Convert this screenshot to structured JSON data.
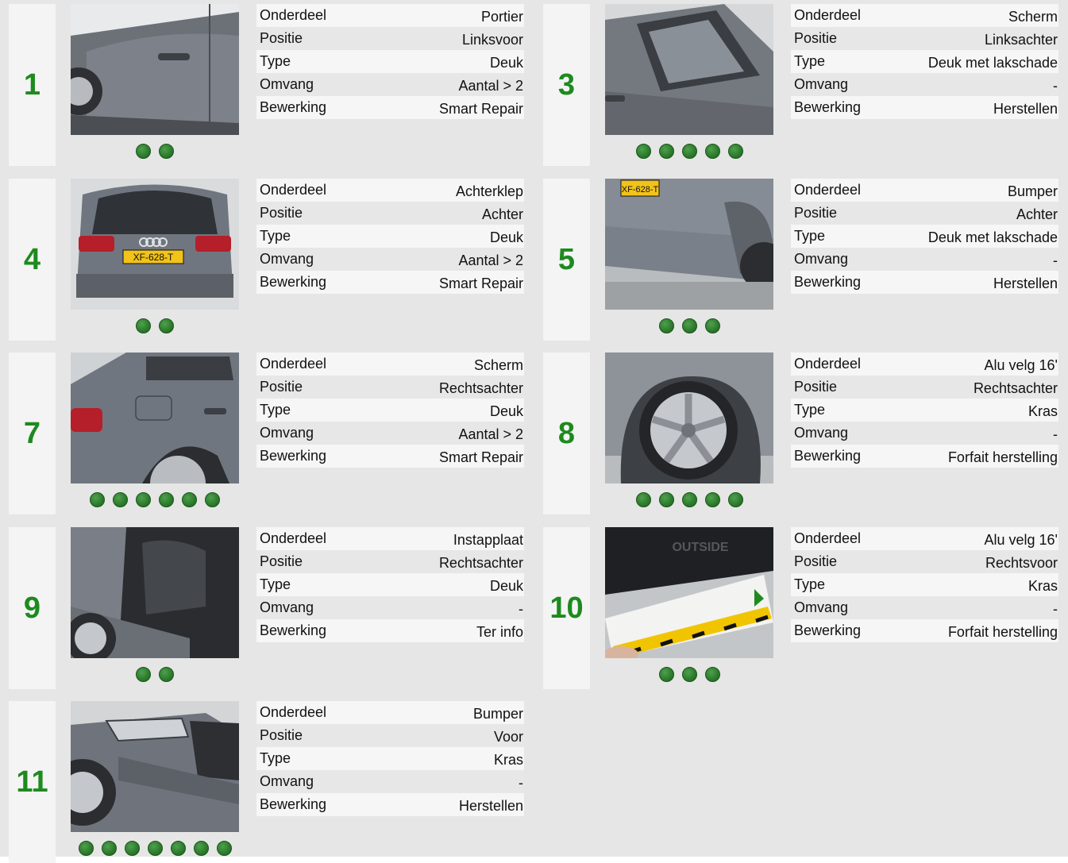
{
  "labels": {
    "onderdeel": "Onderdeel",
    "positie": "Positie",
    "type": "Type",
    "omvang": "Omvang",
    "bewerking": "Bewerking"
  },
  "colors": {
    "number": "#1e8a1e",
    "dot": "#2e7d2e",
    "background": "#e6e6e6",
    "cell_light": "#f6f6f6"
  },
  "damages": [
    {
      "number": "1",
      "photo_icon": "car-door-photo",
      "photos": 2,
      "onderdeel": "Portier",
      "positie": "Linksvoor",
      "type": "Deuk",
      "omvang": "Aantal > 2",
      "bewerking": "Smart Repair"
    },
    {
      "number": "3",
      "photo_icon": "car-rear-window-photo",
      "photos": 5,
      "onderdeel": "Scherm",
      "positie": "Linksachter",
      "type": "Deuk met lakschade",
      "omvang": "-",
      "bewerking": "Herstellen"
    },
    {
      "number": "4",
      "photo_icon": "car-tailgate-photo",
      "photos": 2,
      "onderdeel": "Achterklep",
      "positie": "Achter",
      "type": "Deuk",
      "omvang": "Aantal > 2",
      "bewerking": "Smart Repair"
    },
    {
      "number": "5",
      "photo_icon": "car-rear-bumper-photo",
      "photos": 3,
      "onderdeel": "Bumper",
      "positie": "Achter",
      "type": "Deuk met lakschade",
      "omvang": "-",
      "bewerking": "Herstellen"
    },
    {
      "number": "7",
      "photo_icon": "car-rear-quarter-photo",
      "photos": 6,
      "onderdeel": "Scherm",
      "positie": "Rechtsachter",
      "type": "Deuk",
      "omvang": "Aantal > 2",
      "bewerking": "Smart Repair"
    },
    {
      "number": "8",
      "photo_icon": "car-wheel-photo",
      "photos": 5,
      "onderdeel": "Alu velg 16'",
      "positie": "Rechtsachter",
      "type": "Kras",
      "omvang": "-",
      "bewerking": "Forfait herstelling"
    },
    {
      "number": "9",
      "photo_icon": "car-sill-photo",
      "photos": 2,
      "onderdeel": "Instapplaat",
      "positie": "Rechtsachter",
      "type": "Deuk",
      "omvang": "-",
      "bewerking": "Ter info"
    },
    {
      "number": "10",
      "photo_icon": "wheel-ruler-photo",
      "photos": 3,
      "onderdeel": "Alu velg 16'",
      "positie": "Rechtsvoor",
      "type": "Kras",
      "omvang": "-",
      "bewerking": "Forfait herstelling"
    },
    {
      "number": "11",
      "photo_icon": "car-front-bumper-photo",
      "photos": 7,
      "onderdeel": "Bumper",
      "positie": "Voor",
      "type": "Kras",
      "omvang": "-",
      "bewerking": "Herstellen"
    }
  ],
  "plates": {
    "tailgate": "XF-628-T",
    "bumper": "XF-628-T"
  },
  "ruler_text": "OUTSIDE"
}
